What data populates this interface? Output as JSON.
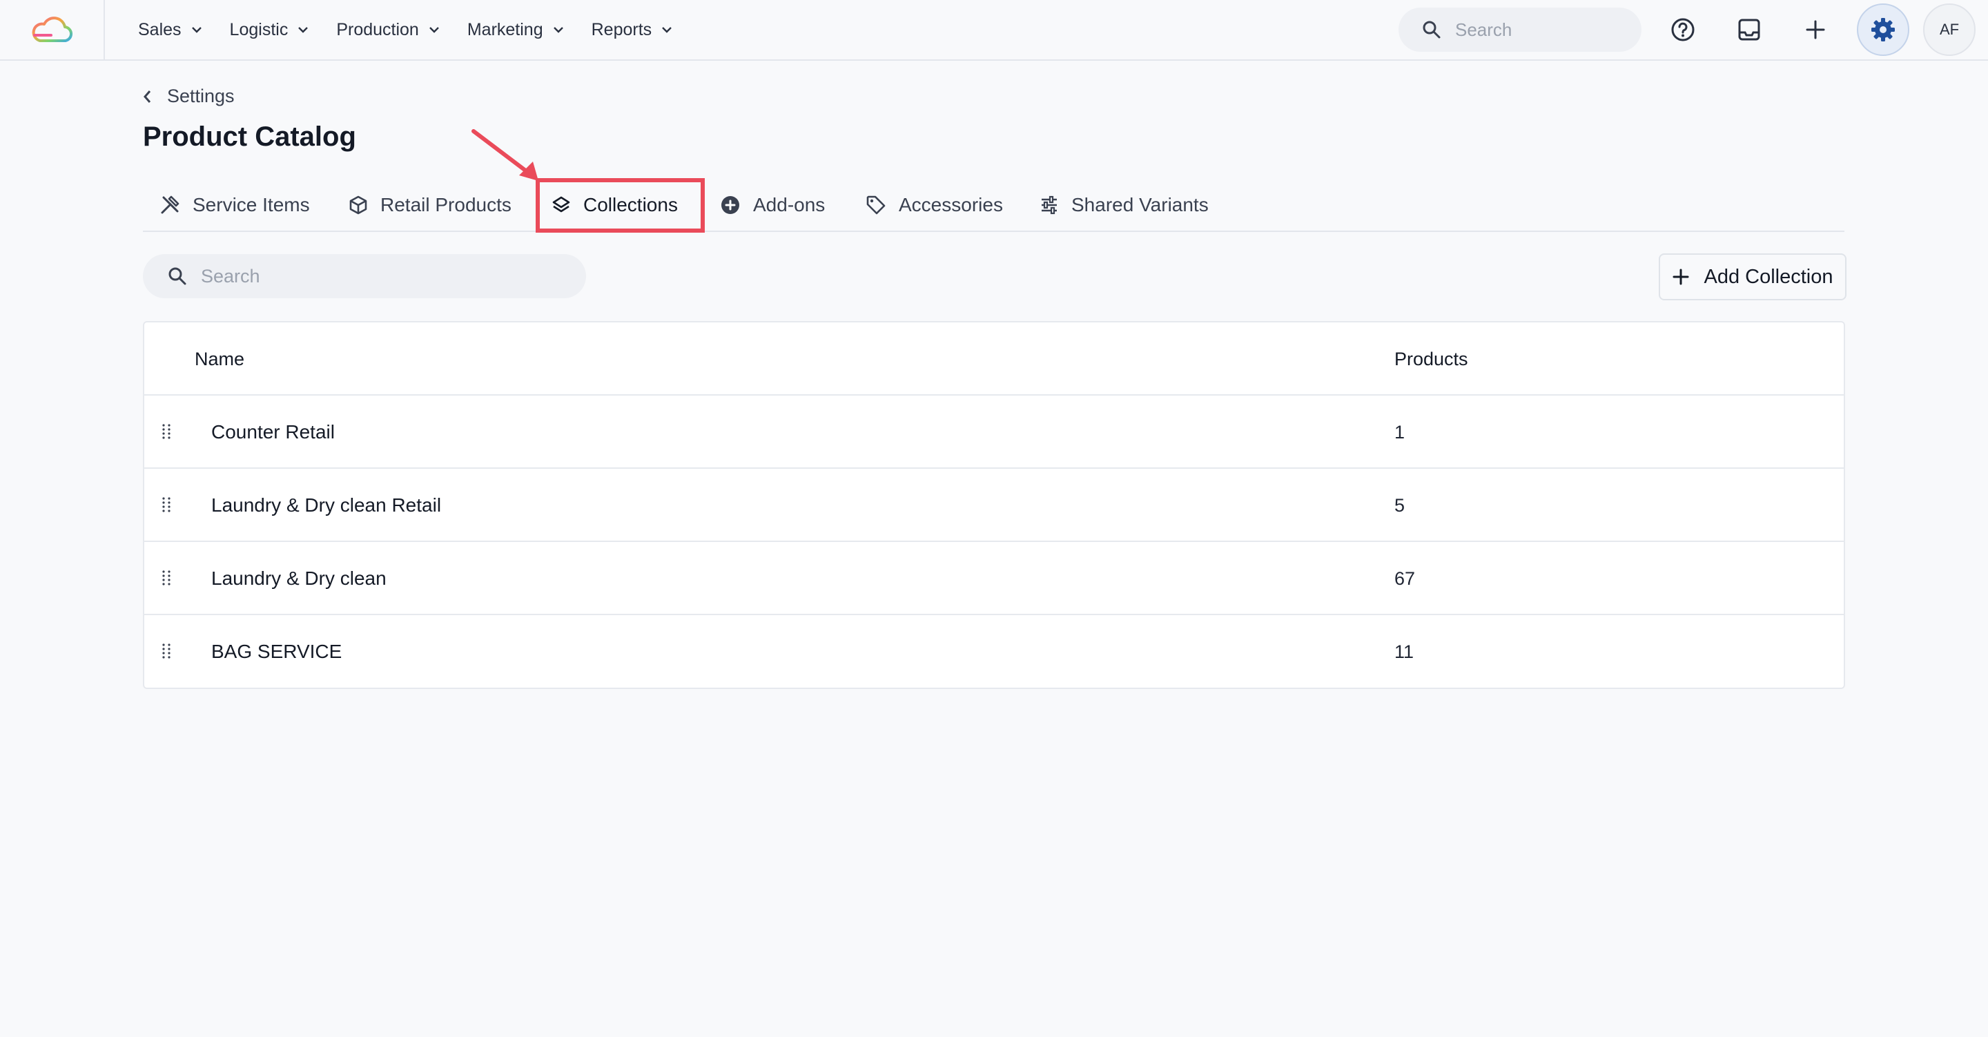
{
  "topbar": {
    "nav": [
      {
        "label": "Sales"
      },
      {
        "label": "Logistic"
      },
      {
        "label": "Production"
      },
      {
        "label": "Marketing"
      },
      {
        "label": "Reports"
      }
    ],
    "search_placeholder": "Search",
    "avatar_initials": "AF"
  },
  "page": {
    "breadcrumb": "Settings",
    "title": "Product Catalog"
  },
  "tabs": [
    {
      "label": "Service Items",
      "icon": "tools-icon"
    },
    {
      "label": "Retail Products",
      "icon": "box-icon"
    },
    {
      "label": "Collections",
      "icon": "layers-icon",
      "active": true
    },
    {
      "label": "Add-ons",
      "icon": "plus-circle-icon"
    },
    {
      "label": "Accessories",
      "icon": "tag-icon"
    },
    {
      "label": "Shared Variants",
      "icon": "sliders-icon"
    }
  ],
  "toolbar": {
    "search_placeholder": "Search",
    "add_label": "Add Collection"
  },
  "table": {
    "columns": [
      "Name",
      "Products"
    ],
    "rows": [
      {
        "name": "Counter Retail",
        "products": "1"
      },
      {
        "name": "Laundry & Dry clean Retail",
        "products": "5"
      },
      {
        "name": "Laundry & Dry clean",
        "products": "67"
      },
      {
        "name": "BAG SERVICE",
        "products": "11"
      }
    ]
  },
  "colors": {
    "highlight": "#ea4b5a",
    "accent": "#1f4f9c"
  }
}
